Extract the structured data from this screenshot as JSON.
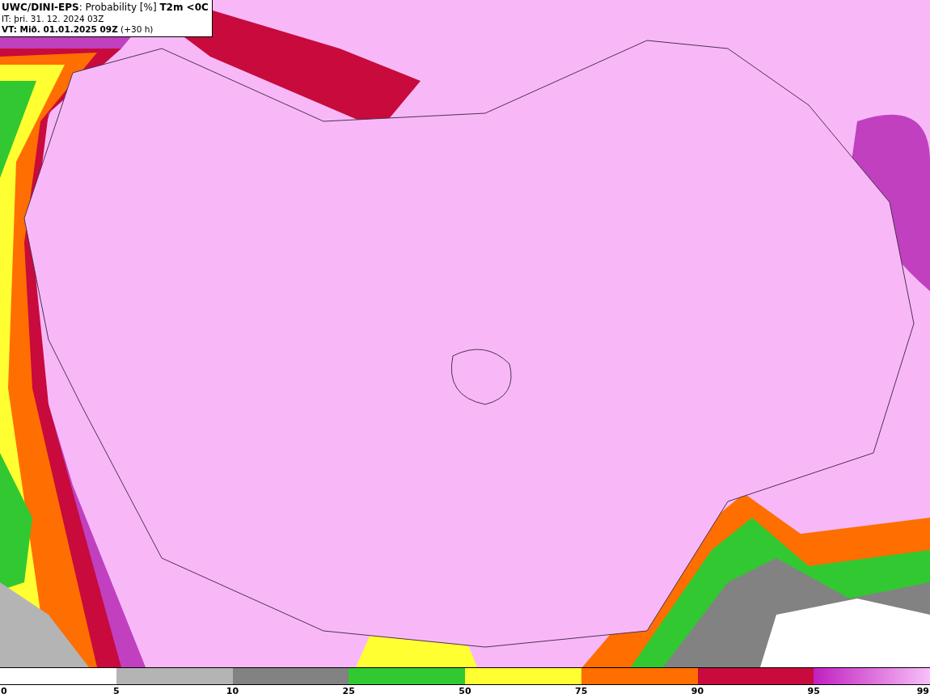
{
  "header": {
    "title": "**UWC/DINI-EPS**: Probability [%] **T2m <0C**",
    "initial_time": "IT: þri. 31. 12. 2024 03Z",
    "valid_time": "**VT: Mið. 01.01.2025 09Z** (+30 h)"
  },
  "legend": {
    "segments": [
      {
        "kind": "empty"
      },
      {
        "kind": "solid",
        "color": "#b4b4b4"
      },
      {
        "kind": "solid",
        "color": "#828282"
      },
      {
        "kind": "solid",
        "color": "#32c832"
      },
      {
        "kind": "solid",
        "color": "#ffff32"
      },
      {
        "kind": "solid",
        "color": "#ff6e00"
      },
      {
        "kind": "solid",
        "color": "#c80a3c"
      },
      {
        "kind": "gradient"
      }
    ],
    "ticks": [
      "0",
      "5",
      "10",
      "25",
      "50",
      "75",
      "90",
      "95",
      "99"
    ]
  }
}
